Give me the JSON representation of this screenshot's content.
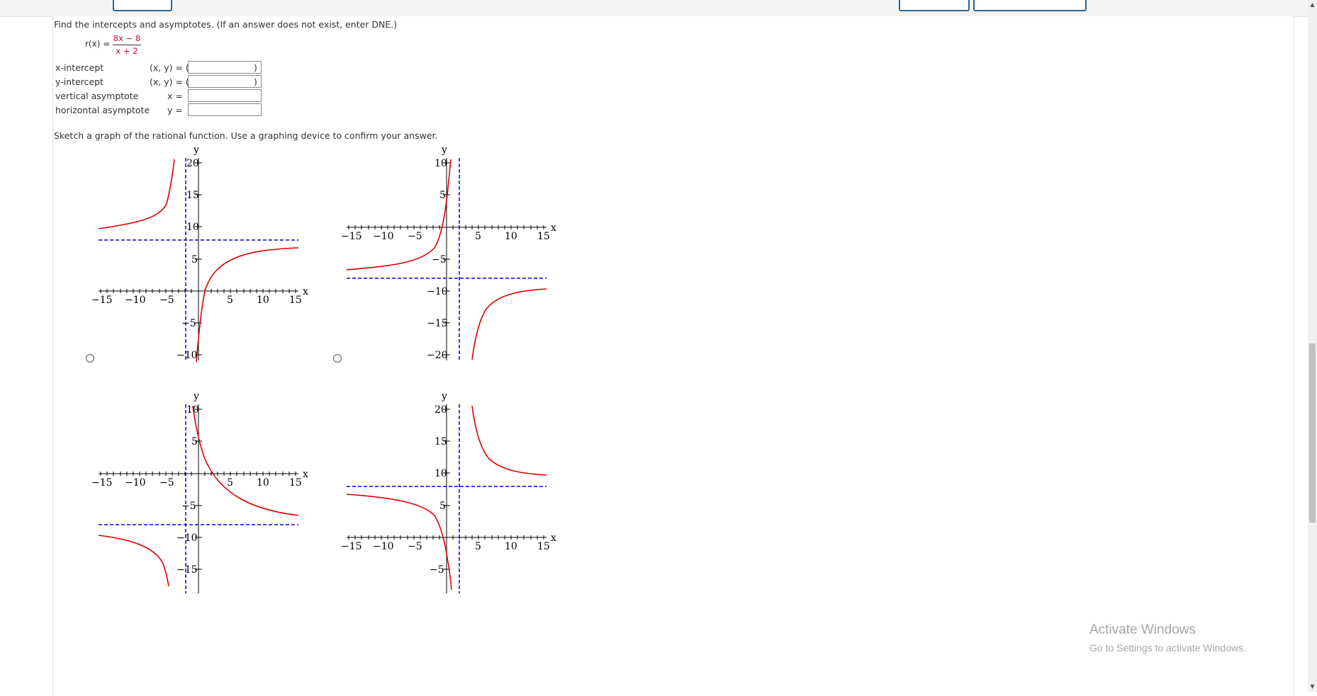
{
  "question": {
    "prompt": "Find the intercepts and asymptotes. (If an answer does not exist, enter DNE.)",
    "function_name": "r(x) =",
    "numerator": "8x − 8",
    "denominator": "x + 2",
    "sketch_prompt": "Sketch a graph of the rational function. Use a graphing device to confirm your answer."
  },
  "answers": [
    {
      "label": "x-intercept",
      "prefix": "(x, y) = (",
      "suffix": ")",
      "value": ""
    },
    {
      "label": "y-intercept",
      "prefix": "(x, y) = (",
      "suffix": ")",
      "value": ""
    },
    {
      "label": "vertical asymptote",
      "prefix": "x =",
      "suffix": "",
      "value": ""
    },
    {
      "label": "horizontal asymptote",
      "prefix": "y =",
      "suffix": "",
      "value": ""
    }
  ],
  "graph_options": [
    {
      "selected": false,
      "x_ticks": [
        "−15",
        "−10",
        "−5",
        "5",
        "10",
        "15"
      ],
      "y_ticks": [
        "20",
        "15",
        "10",
        "5",
        "−5",
        "−10"
      ],
      "x_axis_label": "x",
      "y_axis_label": "y",
      "vertical_asymptote": -2,
      "horizontal_asymptote": 8
    },
    {
      "selected": false,
      "x_ticks": [
        "−15",
        "−10",
        "−5",
        "5",
        "10",
        "15"
      ],
      "y_ticks": [
        "10",
        "5",
        "−5",
        "−10",
        "−15",
        "−20"
      ],
      "x_axis_label": "x",
      "y_axis_label": "y",
      "vertical_asymptote": 2,
      "horizontal_asymptote": -8
    },
    {
      "selected": false,
      "x_ticks": [
        "−15",
        "−10",
        "−5",
        "5",
        "10",
        "15"
      ],
      "y_ticks": [
        "10",
        "5",
        "−5",
        "−10",
        "−15"
      ],
      "x_axis_label": "x",
      "y_axis_label": "y",
      "vertical_asymptote": -2,
      "horizontal_asymptote": -8
    },
    {
      "selected": false,
      "x_ticks": [
        "−15",
        "−10",
        "−5",
        "5",
        "10",
        "15"
      ],
      "y_ticks": [
        "20",
        "15",
        "10",
        "5",
        "−5"
      ],
      "x_axis_label": "x",
      "y_axis_label": "y",
      "vertical_asymptote": 2,
      "horizontal_asymptote": 8
    }
  ],
  "colors": {
    "curve": "#e00000",
    "asymptote": "#0000dd",
    "axis": "#000000",
    "button_border": "#2a6496"
  },
  "watermark": {
    "title": "Activate Windows",
    "subtitle": "Go to Settings to activate Windows."
  },
  "icons": {
    "scroll_up": "triangle-up",
    "scroll_down": "triangle-down"
  }
}
